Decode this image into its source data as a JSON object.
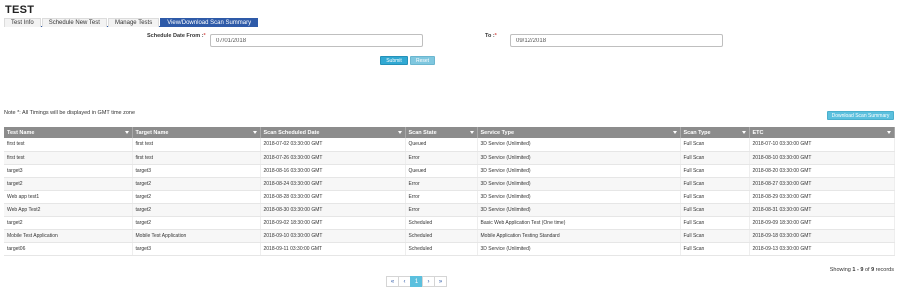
{
  "page": {
    "title": "TEST"
  },
  "tabs": [
    {
      "label": "Test Info",
      "active": false
    },
    {
      "label": "Schedule New Test",
      "active": false
    },
    {
      "label": "Manage Tests",
      "active": false
    },
    {
      "label": "View/Download Scan Summary",
      "active": true
    }
  ],
  "form": {
    "from_label": "Schedule Date From :",
    "from_value": "07/01/2018",
    "to_label": "To :",
    "to_value": "09/12/2018",
    "required_mark": "*",
    "submit_label": "Submit",
    "reset_label": "Reset"
  },
  "note": "Note *: All Timings will be displayed in GMT time zone",
  "download_label": "Download Scan Summary",
  "table": {
    "columns": [
      "Test Name",
      "Target Name",
      "Scan Scheduled Date",
      "Scan State",
      "Service Type",
      "Scan Type",
      "ETC"
    ],
    "rows": [
      [
        "first test",
        "first test",
        "2018-07-02 03:30:00 GMT",
        "Queued",
        "3D Service (Unlimited)",
        "Full Scan",
        "2018-07-10 03:30:00 GMT"
      ],
      [
        "first test",
        "first test",
        "2018-07-26 03:30:00 GMT",
        "Error",
        "3D Service (Unlimited)",
        "Full Scan",
        "2018-08-10 03:30:00 GMT"
      ],
      [
        "target3",
        "target3",
        "2018-08-16 03:30:00 GMT",
        "Queued",
        "3D Service (Unlimited)",
        "Full Scan",
        "2018-08-20 03:30:00 GMT"
      ],
      [
        "target2",
        "target2",
        "2018-08-24 03:30:00 GMT",
        "Error",
        "3D Service (Unlimited)",
        "Full Scan",
        "2018-08-27 03:30:00 GMT"
      ],
      [
        "Web app test1",
        "target2",
        "2018-08-28 03:30:00 GMT",
        "Error",
        "3D Service (Unlimited)",
        "Full Scan",
        "2018-08-29 03:30:00 GMT"
      ],
      [
        "Web App Test2",
        "target2",
        "2018-08-30 03:30:00 GMT",
        "Error",
        "3D Service (Unlimited)",
        "Full Scan",
        "2018-08-31 03:30:00 GMT"
      ],
      [
        "target2",
        "target2",
        "2018-09-02 18:30:00 GMT",
        "Scheduled",
        "Basic Web Application Test (One time)",
        "Full Scan",
        "2018-09-09 18:30:00 GMT"
      ],
      [
        "Mobile Test Application",
        "Mobile Test Application",
        "2018-09-10 03:30:00 GMT",
        "Scheduled",
        "Mobile Application Testing Standard",
        "Full Scan",
        "2018-09-18 03:30:00 GMT"
      ],
      [
        "target06",
        "target3",
        "2018-09-11 03:30:00 GMT",
        "Scheduled",
        "3D Service (Unlimited)",
        "Full Scan",
        "2018-09-13 03:30:00 GMT"
      ]
    ]
  },
  "records": {
    "prefix": "Showing",
    "range": "1 - 9",
    "of_text": "of",
    "total": "9",
    "suffix": "records"
  },
  "pagination": {
    "first": "«",
    "prev": "‹",
    "current": "1",
    "next": "›",
    "last": "»"
  },
  "colors": {
    "accent": "#2e5aa8",
    "button": "#31a9d3",
    "header": "#8c8c8c"
  }
}
